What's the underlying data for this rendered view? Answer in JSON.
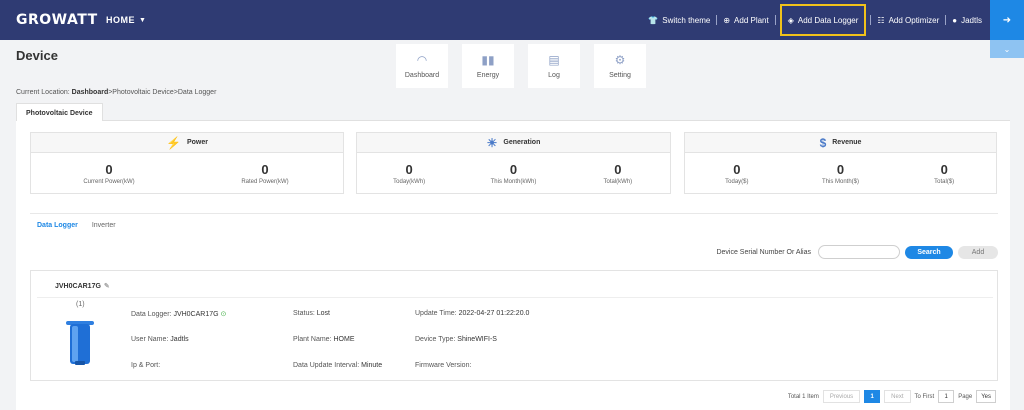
{
  "nav": {
    "logo": "GROWATT",
    "home": "HOME",
    "items": [
      {
        "icon": "shirt-icon",
        "label": "Switch theme"
      },
      {
        "icon": "plus-circle-icon",
        "label": "Add Plant"
      },
      {
        "icon": "tag-icon",
        "label": "Add Data Logger"
      },
      {
        "icon": "optimizer-icon",
        "label": "Add Optimizer"
      },
      {
        "icon": "user-icon",
        "label": "Jadtls"
      }
    ]
  },
  "page": {
    "title": "Device",
    "breadcrumb_prefix": "Current Location:",
    "breadcrumb_dashboard": "Dashboard",
    "breadcrumb_rest": ">Photovoltaic Device>Data Logger",
    "tab": "Photovoltaic Device"
  },
  "tools": [
    {
      "icon": "gauge-icon",
      "label": "Dashboard"
    },
    {
      "icon": "bar-chart-icon",
      "label": "Energy"
    },
    {
      "icon": "log-icon",
      "label": "Log"
    },
    {
      "icon": "gear-icon",
      "label": "Setting"
    }
  ],
  "stats": {
    "power": {
      "title": "Power",
      "cells": [
        {
          "value": "0",
          "label": "Current Power(kW)"
        },
        {
          "value": "0",
          "label": "Rated Power(kW)"
        }
      ]
    },
    "generation": {
      "title": "Generation",
      "cells": [
        {
          "value": "0",
          "label": "Today(kWh)"
        },
        {
          "value": "0",
          "label": "This Month(kWh)"
        },
        {
          "value": "0",
          "label": "Total(kWh)"
        }
      ]
    },
    "revenue": {
      "title": "Revenue",
      "cells": [
        {
          "value": "0",
          "label": "Today($)"
        },
        {
          "value": "0",
          "label": "This Month($)"
        },
        {
          "value": "0",
          "label": "Total($)"
        }
      ]
    }
  },
  "subtabs": {
    "active": "Data Logger",
    "other": "Inverter"
  },
  "search": {
    "label": "Device Serial Number Or Alias",
    "placeholder": "",
    "search_button": "Search",
    "add_button": "Add"
  },
  "device": {
    "name": "JVH0CAR17G",
    "count": "(1)",
    "data_logger_label": "Data Logger:",
    "data_logger_value": "JVH0CAR17G",
    "status_label": "Status:",
    "status_value": "Lost",
    "update_time_label": "Update Time:",
    "update_time_value": "2022-04-27 01:22:20.0",
    "user_name_label": "User Name:",
    "user_name_value": "Jadtls",
    "plant_name_label": "Plant Name:",
    "plant_name_value": "HOME",
    "device_type_label": "Device Type:",
    "device_type_value": "ShineWIFI-S",
    "ip_port_label": "Ip & Port:",
    "interval_label": "Data Update Interval:",
    "interval_value": "Minute",
    "firmware_label": "Firmware Version:"
  },
  "pager": {
    "total": "Total 1 Item",
    "previous": "Previous",
    "current": "1",
    "next": "Next",
    "to_first": "To First",
    "page_input": "1",
    "page": "Page",
    "yes": "Yes"
  },
  "colors": {
    "nav_bg": "#2f3b73",
    "accent": "#1e88e5",
    "highlight": "#f1c21b"
  }
}
